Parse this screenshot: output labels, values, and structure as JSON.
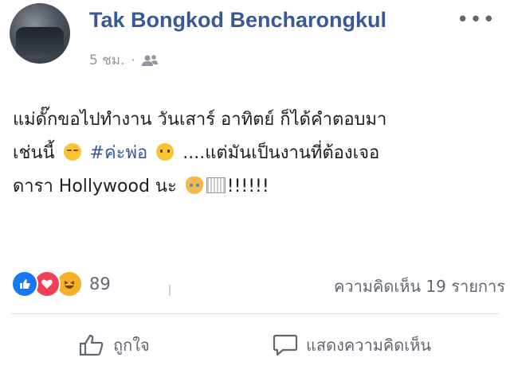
{
  "post": {
    "author": "Tak Bongkod Bencharongkul",
    "timestamp": "5 ชม.",
    "separator": "·",
    "audience_icon": "friends-icon",
    "more_icon": "more-options-icon",
    "text": {
      "line1": "แม่ดั๊กขอไปทำงาน วันเสาร์ อาทิตย์ ก็ได้คำตอบมา",
      "line2_prefix": "เช่นนี้",
      "hashtag": "#ค่ะพ่อ",
      "line2_suffix": "....แต่มันเป็นงานที่ต้องเจอ",
      "line3_prefix": "ดารา Hollywood นะ",
      "line3_suffix": "!!!!!!"
    }
  },
  "reactions": {
    "types": [
      "like-icon",
      "love-icon",
      "haha-icon"
    ],
    "count": "89",
    "colors": {
      "like": "#1877f2",
      "love": "#f33e58",
      "haha": "#f7b125"
    }
  },
  "comments": {
    "label": "ความคิดเห็น 19 รายการ"
  },
  "actions": {
    "like_label": "ถูกใจ",
    "comment_label": "แสดงความคิดเห็น"
  },
  "colors": {
    "author": "#385898",
    "hashtag": "#365899",
    "meta": "#90949c"
  }
}
